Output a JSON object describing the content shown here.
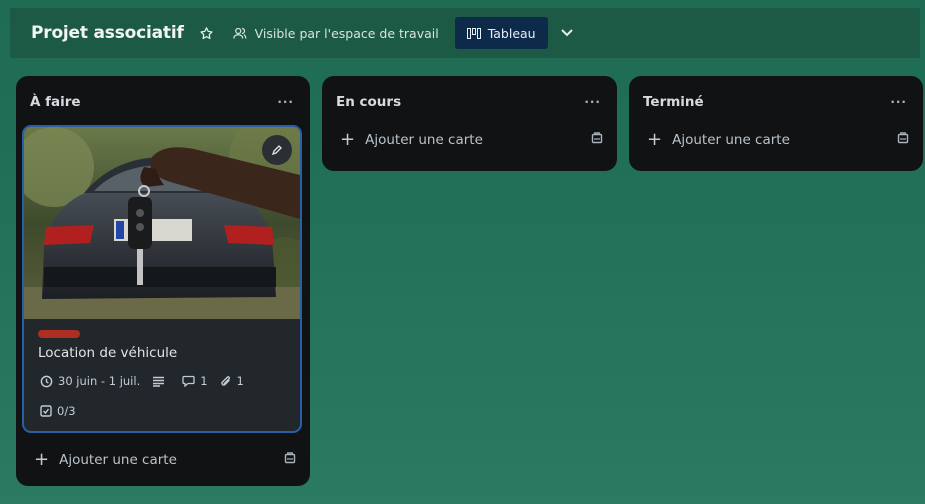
{
  "header": {
    "board_title": "Projet associatif",
    "visibility_label": "Visible par l'espace de travail",
    "view_label": "Tableau"
  },
  "lists": [
    {
      "title": "À faire",
      "menu": "···",
      "add_card_label": "Ajouter une carte",
      "cards": [
        {
          "title": "Location de véhicule",
          "label_color": "#ae2e24",
          "due": "30 juin - 1 juil.",
          "comments": "1",
          "attachments": "1",
          "checklist": "0/3"
        }
      ]
    },
    {
      "title": "En cours",
      "menu": "···",
      "add_card_label": "Ajouter une carte",
      "cards": []
    },
    {
      "title": "Terminé",
      "menu": "···",
      "add_card_label": "Ajouter une carte",
      "cards": []
    }
  ],
  "colors": {
    "board_background": "#227058",
    "list_background": "#111213",
    "card_background": "#22272b",
    "card_border": "#2a5ea8",
    "view_button": "#0d2a4a"
  }
}
